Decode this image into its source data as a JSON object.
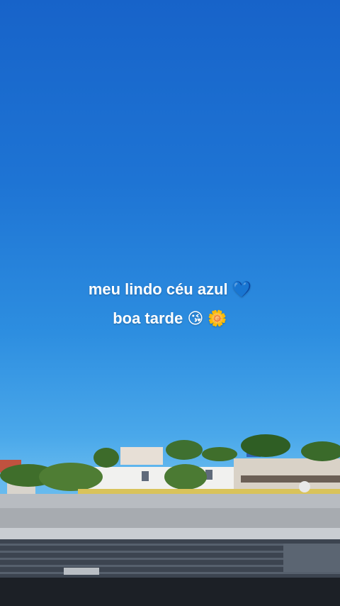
{
  "caption": {
    "line1_text": "meu lindo céu azul",
    "line1_emoji": "💙",
    "line2_text": "boa tarde",
    "line2_emoji_kiss": "😘",
    "line2_emoji_flower": "🌼"
  },
  "colors": {
    "sky_top": "#1763c9",
    "sky_bottom": "#7cc3ef",
    "text": "#ffffff"
  }
}
